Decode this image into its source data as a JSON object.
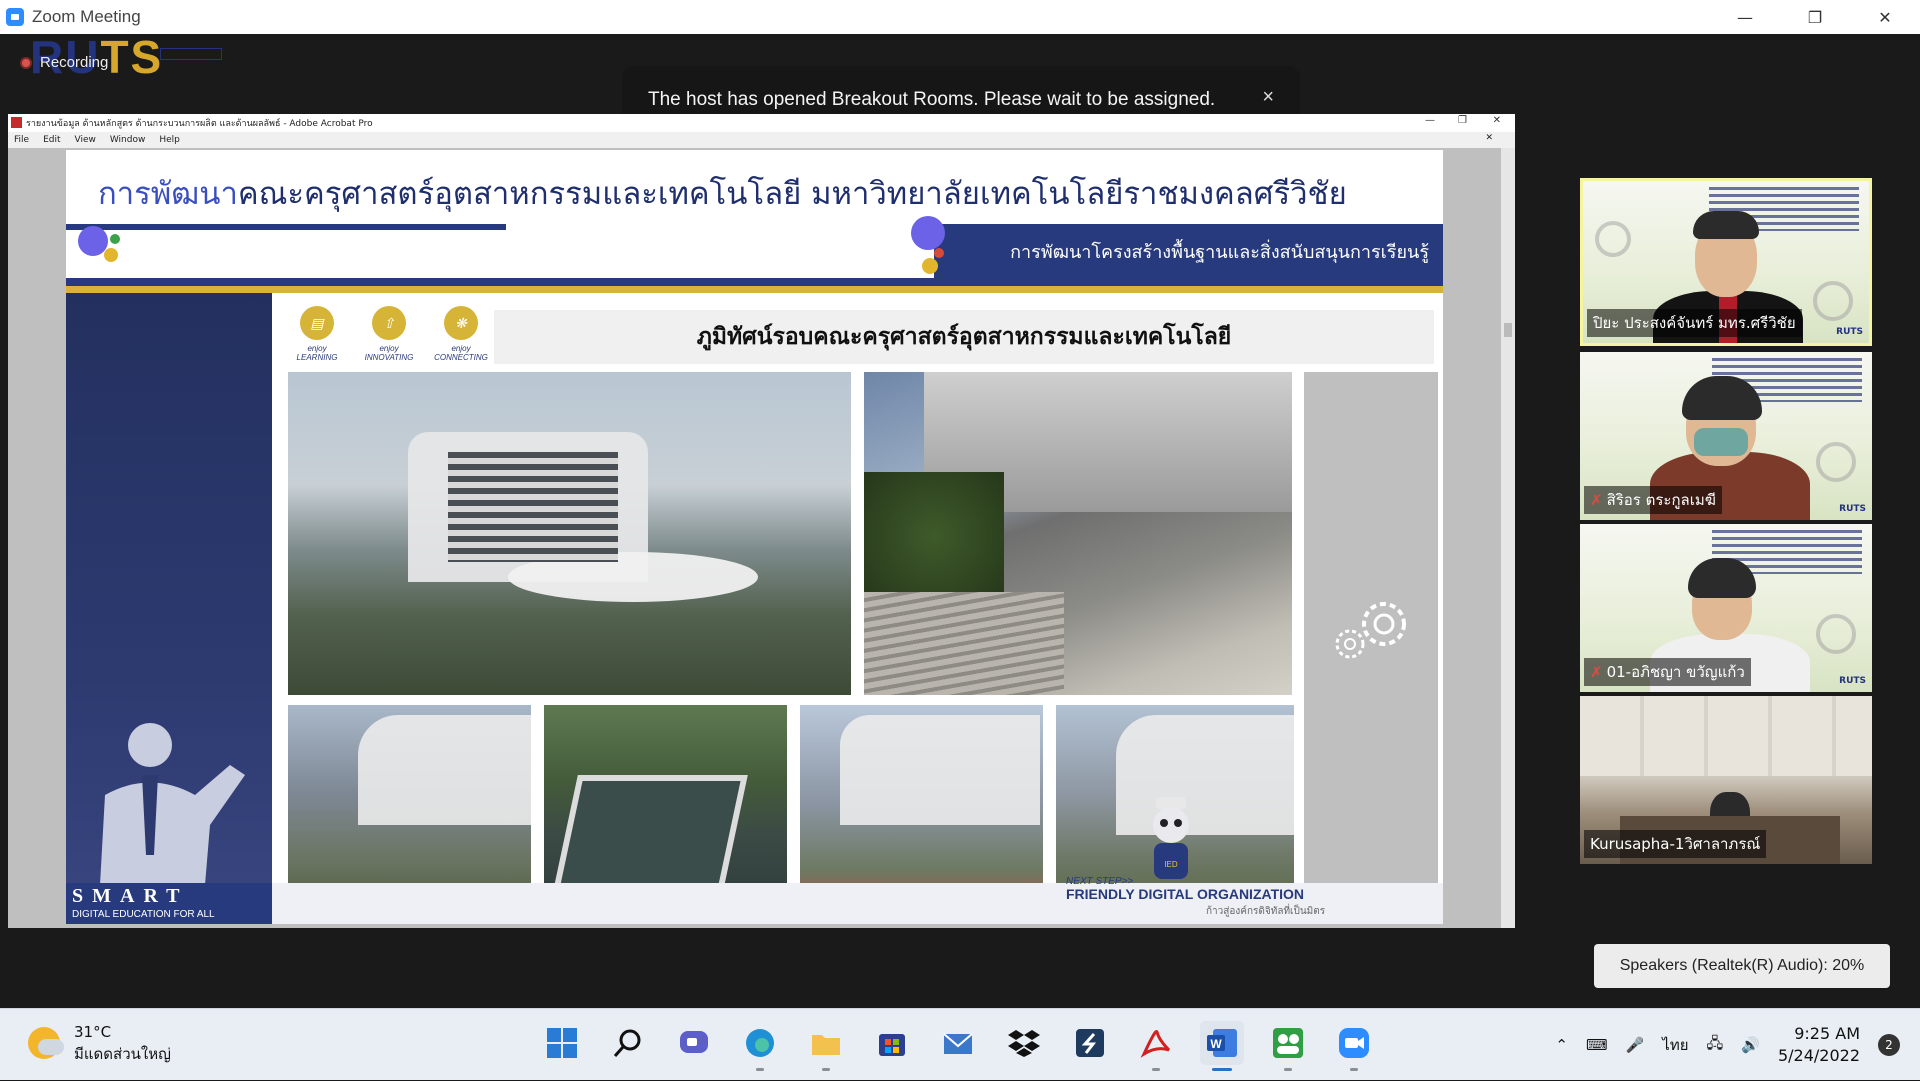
{
  "window": {
    "title": "Zoom Meeting",
    "minimize_icon": "minimize-icon",
    "restore_icon": "restore-icon",
    "close_icon": "close-icon"
  },
  "meeting": {
    "recording_label": "Recording",
    "watermark_left": "RU",
    "watermark_right": "TS",
    "banner_text": "The host has opened Breakout Rooms. Please wait to be assigned.",
    "banner_close": "×"
  },
  "acrobat": {
    "title": "รายงานข้อมูล ด้านหลักสูตร ด้านกระบวนการผลิต และด้านผลลัพธ์ - Adobe Acrobat Pro",
    "menu": [
      "File",
      "Edit",
      "View",
      "Window",
      "Help"
    ]
  },
  "slide": {
    "heading_accent": "การพัฒนา",
    "heading_rest": "คณะครุศาสตร์อุตสาหกรรมและเทคโนโลยี มหาวิทยาลัยเทคโนโลยีราชมงคลศรีวิชัย",
    "subheading": "การพัฒนาโครงสร้างพื้นฐานและสิ่งสนับสนุนการเรียนรู้",
    "enjoy": [
      {
        "line1": "enjoy",
        "line2": "LEARNING"
      },
      {
        "line1": "enjoy",
        "line2": "INNOVATING"
      },
      {
        "line1": "enjoy",
        "line2": "CONNECTING"
      }
    ],
    "panorama_title": "ภูมิทัศน์รอบคณะครุศาสตร์อุตสาหกรรมและเทคโนโลยี",
    "smart_title": "SMART",
    "smart_sub": "DIGITAL EDUCATION FOR ALL",
    "next_step": "NEXT STEP>>",
    "friendly": "FRIENDLY DIGITAL ORGANIZATION",
    "friendly_sub": "ก้าวสู่องค์กรดิจิทัลที่เป็นมิตร"
  },
  "participants": [
    {
      "name": "ปิยะ ประสงค์จันทร์ มทร.ศรีวิชัย",
      "muted": false
    },
    {
      "name": "สิริอร ตระกูลเมฆี",
      "muted": true
    },
    {
      "name": "01-อภิชญา ขวัญแก้ว",
      "muted": true
    },
    {
      "name": "Kurusapha-1วิศาลาภรณ์",
      "muted": false
    }
  ],
  "tile_watermark": "RUTS",
  "speakers": "Speakers (Realtek(R) Audio): 20%",
  "taskbar": {
    "temperature": "31°C",
    "weather_desc": "มีแดดส่วนใหญ่",
    "apps": [
      "windows-start-icon",
      "search-icon",
      "chat-icon",
      "edge-icon",
      "file-explorer-icon",
      "store-icon",
      "mail-icon",
      "dropbox-icon",
      "app-s-icon",
      "acrobat-icon",
      "word-icon",
      "teams-icon",
      "zoom-icon"
    ],
    "language": "ไทย",
    "time": "9:25 AM",
    "date": "5/24/2022",
    "notifications": "2"
  }
}
